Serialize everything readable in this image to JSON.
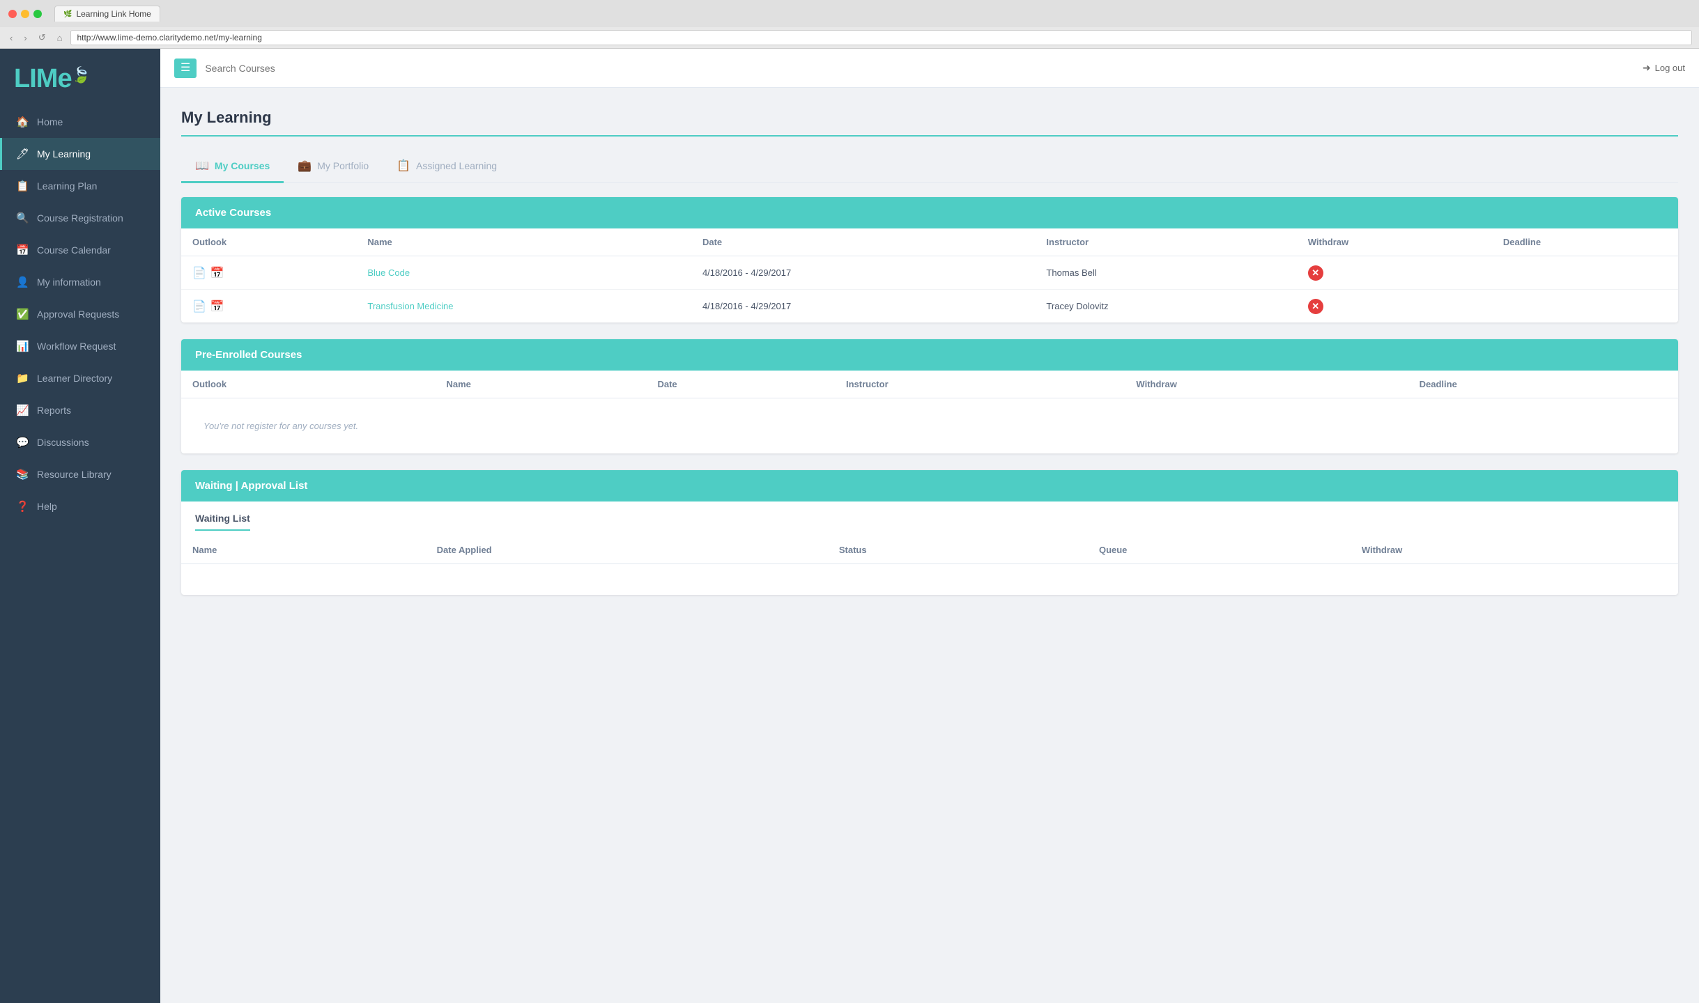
{
  "browser": {
    "tab_title": "Learning Link Home",
    "address": "http://www.lime-demo.claritydemo.net/my-learning",
    "nav_back": "‹",
    "nav_forward": "›",
    "nav_refresh": "↺",
    "nav_home": "⌂"
  },
  "topbar": {
    "search_placeholder": "Search Courses",
    "logout_label": "Log out"
  },
  "sidebar": {
    "logo": "LIMe",
    "nav_items": [
      {
        "id": "home",
        "label": "Home",
        "icon": "🏠"
      },
      {
        "id": "my-learning",
        "label": "My Learning",
        "icon": "🖊",
        "active": true
      },
      {
        "id": "learning-plan",
        "label": "Learning Plan",
        "icon": "📋"
      },
      {
        "id": "course-registration",
        "label": "Course Registration",
        "icon": "🔍"
      },
      {
        "id": "course-calendar",
        "label": "Course Calendar",
        "icon": "📅"
      },
      {
        "id": "my-information",
        "label": "My information",
        "icon": "👤"
      },
      {
        "id": "approval-requests",
        "label": "Approval Requests",
        "icon": "✅"
      },
      {
        "id": "workflow-request",
        "label": "Workflow Request",
        "icon": "📊"
      },
      {
        "id": "learner-directory",
        "label": "Learner Directory",
        "icon": "📁"
      },
      {
        "id": "reports",
        "label": "Reports",
        "icon": "📈"
      },
      {
        "id": "discussions",
        "label": "Discussions",
        "icon": "💬"
      },
      {
        "id": "resource-library",
        "label": "Resource Library",
        "icon": "📚"
      },
      {
        "id": "help",
        "label": "Help",
        "icon": "❓"
      }
    ]
  },
  "page": {
    "title": "My Learning",
    "tabs": [
      {
        "id": "my-courses",
        "label": "My Courses",
        "icon": "📖",
        "active": true
      },
      {
        "id": "my-portfolio",
        "label": "My Portfolio",
        "icon": "💼"
      },
      {
        "id": "assigned-learning",
        "label": "Assigned Learning",
        "icon": "📋"
      }
    ]
  },
  "active_courses": {
    "header": "Active Courses",
    "columns": [
      "Outlook",
      "Name",
      "Date",
      "Instructor",
      "Withdraw",
      "Deadline"
    ],
    "rows": [
      {
        "outlook_icons": [
          "📄",
          "📅"
        ],
        "name": "Blue Code",
        "date": "4/18/2016 - 4/29/2017",
        "instructor": "Thomas Bell",
        "has_withdraw": true
      },
      {
        "outlook_icons": [
          "📄",
          "📅"
        ],
        "name": "Transfusion Medicine",
        "date": "4/18/2016 - 4/29/2017",
        "instructor": "Tracey Dolovitz",
        "has_withdraw": true
      }
    ]
  },
  "pre_enrolled": {
    "header": "Pre-Enrolled Courses",
    "columns": [
      "Outlook",
      "Name",
      "Date",
      "Instructor",
      "Withdraw",
      "Deadline"
    ],
    "empty_message": "You're not register for any courses yet."
  },
  "waiting_approval": {
    "header": "Waiting | Approval List",
    "waiting_list_title": "Waiting List",
    "columns": [
      "Name",
      "Date Applied",
      "Status",
      "Queue",
      "Withdraw"
    ]
  }
}
